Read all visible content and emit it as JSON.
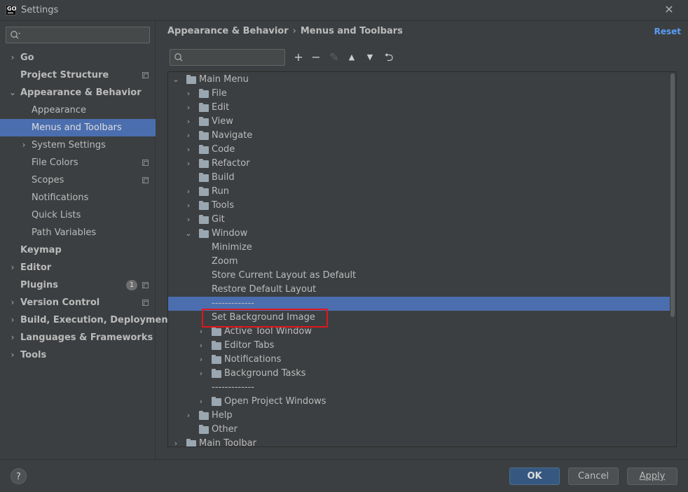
{
  "window": {
    "title": "Settings",
    "logo_text": "GO"
  },
  "sidebar": {
    "search_placeholder": "",
    "items": [
      {
        "label": "Go",
        "arrow": "›",
        "bold": true
      },
      {
        "label": "Project Structure",
        "bold": true,
        "copy_icon": true
      },
      {
        "label": "Appearance & Behavior",
        "arrow": "⌄",
        "bold": true
      },
      {
        "label": "Appearance"
      },
      {
        "label": "Menus and Toolbars",
        "selected": true
      },
      {
        "label": "System Settings",
        "arrow": "›"
      },
      {
        "label": "File Colors",
        "copy_icon": true
      },
      {
        "label": "Scopes",
        "copy_icon": true
      },
      {
        "label": "Notifications"
      },
      {
        "label": "Quick Lists"
      },
      {
        "label": "Path Variables"
      },
      {
        "label": "Keymap",
        "bold": true
      },
      {
        "label": "Editor",
        "arrow": "›",
        "bold": true
      },
      {
        "label": "Plugins",
        "bold": true,
        "badge": "1",
        "copy_icon": true
      },
      {
        "label": "Version Control",
        "arrow": "›",
        "bold": true,
        "copy_icon": true
      },
      {
        "label": "Build, Execution, Deployment",
        "arrow": "›",
        "bold": true
      },
      {
        "label": "Languages & Frameworks",
        "arrow": "›",
        "bold": true
      },
      {
        "label": "Tools",
        "arrow": "›",
        "bold": true
      }
    ]
  },
  "breadcrumb": {
    "parent": "Appearance & Behavior",
    "separator": "›",
    "current": "Menus and Toolbars"
  },
  "reset_label": "Reset",
  "toolbar": {
    "search_placeholder": "",
    "buttons": [
      {
        "name": "add-icon",
        "glyph": "+"
      },
      {
        "name": "remove-icon",
        "glyph": "−"
      },
      {
        "name": "edit-icon",
        "glyph": "✎",
        "disabled": true
      },
      {
        "name": "move-up-icon",
        "glyph": "▲"
      },
      {
        "name": "move-down-icon",
        "glyph": "▼"
      },
      {
        "name": "restore-icon",
        "glyph": "⮌"
      }
    ]
  },
  "tree": {
    "rows": [
      {
        "label": "Main Menu",
        "level": 0,
        "arrow": "⌄",
        "folder": true
      },
      {
        "label": "File",
        "level": 1,
        "arrow": "›",
        "folder": true
      },
      {
        "label": "Edit",
        "level": 1,
        "arrow": "›",
        "folder": true
      },
      {
        "label": "View",
        "level": 1,
        "arrow": "›",
        "folder": true
      },
      {
        "label": "Navigate",
        "level": 1,
        "arrow": "›",
        "folder": true
      },
      {
        "label": "Code",
        "level": 1,
        "arrow": "›",
        "folder": true
      },
      {
        "label": "Refactor",
        "level": 1,
        "arrow": "›",
        "folder": true
      },
      {
        "label": "Build",
        "level": 1,
        "folder": true
      },
      {
        "label": "Run",
        "level": 1,
        "arrow": "›",
        "folder": true
      },
      {
        "label": "Tools",
        "level": 1,
        "arrow": "›",
        "folder": true
      },
      {
        "label": "Git",
        "level": 1,
        "arrow": "›",
        "folder": true
      },
      {
        "label": "Window",
        "level": 1,
        "arrow": "⌄",
        "folder": true
      },
      {
        "label": "Minimize",
        "level": 2
      },
      {
        "label": "Zoom",
        "level": 2
      },
      {
        "label": "Store Current Layout as Default",
        "level": 2
      },
      {
        "label": "Restore Default Layout",
        "level": 2
      },
      {
        "label": "-------------",
        "level": 2,
        "selected": true
      },
      {
        "label": "Set Background Image",
        "level": 2
      },
      {
        "label": "Active Tool Window",
        "level": 2,
        "arrow": "›",
        "folder": true
      },
      {
        "label": "Editor Tabs",
        "level": 2,
        "arrow": "›",
        "folder": true
      },
      {
        "label": "Notifications",
        "level": 2,
        "arrow": "›",
        "folder": true
      },
      {
        "label": "Background Tasks",
        "level": 2,
        "arrow": "›",
        "folder": true
      },
      {
        "label": "-------------",
        "level": 2
      },
      {
        "label": "Open Project Windows",
        "level": 2,
        "arrow": "›",
        "folder": true
      },
      {
        "label": "Help",
        "level": 1,
        "arrow": "›",
        "folder": true
      },
      {
        "label": "Other",
        "level": 1,
        "folder": true
      },
      {
        "label": "Main Toolbar",
        "level": 0,
        "arrow": "›",
        "folder": true
      }
    ]
  },
  "footer": {
    "help_label": "?",
    "ok_label": "OK",
    "cancel_label": "Cancel",
    "apply_label": "Apply"
  },
  "colors": {
    "accent": "#4b6eaf",
    "link": "#589df6",
    "highlight_border": "#e0161d",
    "background": "#3c3f41"
  }
}
